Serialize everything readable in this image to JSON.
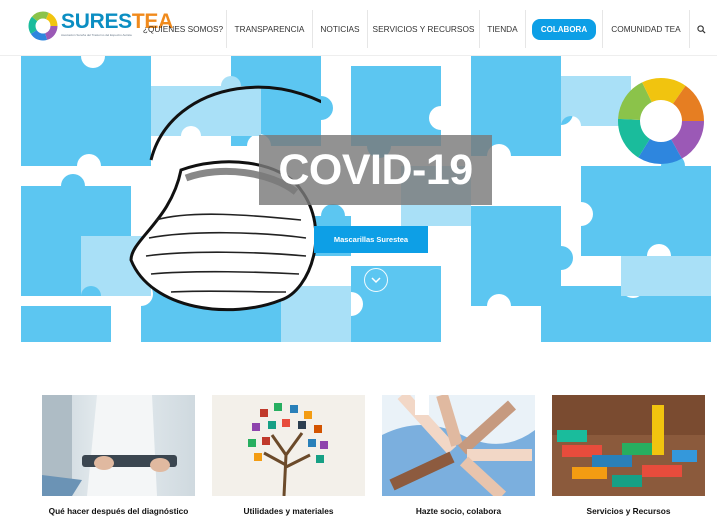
{
  "header": {
    "logo": {
      "text_part1": "SURES",
      "text_part2": "TEA",
      "tagline": "Asociación Sureña del Trastorno del Espectro Autista"
    },
    "nav": [
      {
        "label": "¿QUIENES SOMOS?"
      },
      {
        "label": "TRANSPARENCIA"
      },
      {
        "label": "NOTICIAS"
      },
      {
        "label": "SERVICIOS Y RECURSOS"
      },
      {
        "label": "TIENDA"
      },
      {
        "label": "COLABORA"
      },
      {
        "label": "COMUNIDAD TEA"
      }
    ],
    "search_icon": "search-icon"
  },
  "hero": {
    "title": "COVID-19",
    "button_label": "Mascarillas Surestea",
    "scroll_icon": "chevron-down-icon",
    "colors": {
      "puzzle": "#5cc6f1",
      "button": "#0d9fe6"
    }
  },
  "cards": [
    {
      "label": "Qué hacer después del diagnóstico"
    },
    {
      "label": "Utilidades y materiales"
    },
    {
      "label": "Hazte socio, colabora"
    },
    {
      "label": "Servicios y Recursos"
    }
  ]
}
